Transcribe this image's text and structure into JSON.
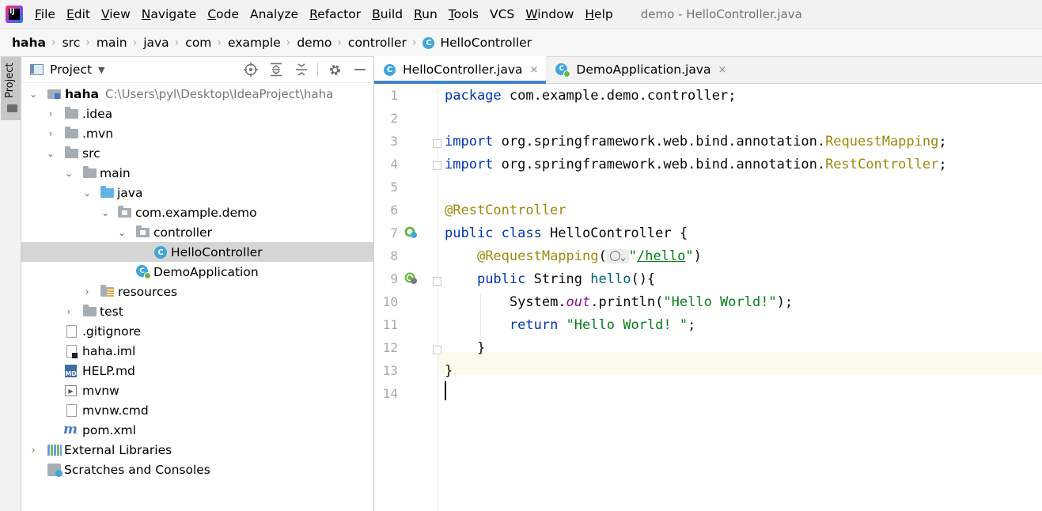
{
  "menu": {
    "items": [
      {
        "label": "File",
        "mnemonic": "F",
        "rest": "ile"
      },
      {
        "label": "Edit",
        "mnemonic": "E",
        "rest": "dit"
      },
      {
        "label": "View",
        "mnemonic": "V",
        "rest": "iew"
      },
      {
        "label": "Navigate",
        "mnemonic": "N",
        "rest": "avigate"
      },
      {
        "label": "Code",
        "mnemonic": "C",
        "rest": "ode"
      },
      {
        "label": "Analyze",
        "mnemonic": "",
        "rest": "Analyze"
      },
      {
        "label": "Refactor",
        "mnemonic": "R",
        "rest": "efactor"
      },
      {
        "label": "Build",
        "mnemonic": "B",
        "rest": "uild"
      },
      {
        "label": "Run",
        "mnemonic": "R",
        "rest": "un"
      },
      {
        "label": "Tools",
        "mnemonic": "T",
        "rest": "ools"
      },
      {
        "label": "VCS",
        "mnemonic": "",
        "rest": "VCS"
      },
      {
        "label": "Window",
        "mnemonic": "W",
        "rest": "indow"
      },
      {
        "label": "Help",
        "mnemonic": "H",
        "rest": "elp"
      }
    ],
    "window_title": "demo - HelloController.java",
    "logo_text": "IJ"
  },
  "breadcrumb": {
    "root": "haha",
    "items": [
      "src",
      "main",
      "java",
      "com",
      "example",
      "demo",
      "controller"
    ],
    "current": "HelloController"
  },
  "sidebar_stripe": {
    "label": "Project"
  },
  "project_panel": {
    "title": "Project",
    "tools": [
      "locate-icon",
      "expand-all-icon",
      "collapse-all-icon",
      "gear-icon",
      "minimize-icon"
    ],
    "tree": [
      {
        "label": "haha",
        "path": "C:\\Users\\pyl\\Desktop\\IdeaProject\\haha"
      },
      {
        "label": ".idea"
      },
      {
        "label": ".mvn"
      },
      {
        "label": "src"
      },
      {
        "label": "main"
      },
      {
        "label": "java"
      },
      {
        "label": "com.example.demo"
      },
      {
        "label": "controller"
      },
      {
        "label": "HelloController"
      },
      {
        "label": "DemoApplication"
      },
      {
        "label": "resources"
      },
      {
        "label": "test"
      },
      {
        "label": ".gitignore"
      },
      {
        "label": "haha.iml"
      },
      {
        "label": "HELP.md"
      },
      {
        "label": "mvnw"
      },
      {
        "label": "mvnw.cmd"
      },
      {
        "label": "pom.xml"
      },
      {
        "label": "External Libraries"
      },
      {
        "label": "Scratches and Consoles"
      }
    ],
    "md_badge": "MD",
    "pom_glyph": "m",
    "class_glyph": "C"
  },
  "editor": {
    "tabs": [
      {
        "label": "HelloController.java",
        "close": "×"
      },
      {
        "label": "DemoApplication.java",
        "close": "×"
      }
    ],
    "line_numbers": [
      "1",
      "2",
      "3",
      "4",
      "5",
      "6",
      "7",
      "8",
      "9",
      "10",
      "11",
      "12",
      "13",
      "14"
    ],
    "code": {
      "l1_kw": "package",
      "l1_rest": " com.example.demo.controller;",
      "l3_kw": "import",
      "l3_pkg": " org.springframework.web.bind.annotation.",
      "l3_cls": "RequestMapping",
      "l3_end": ";",
      "l4_kw": "import",
      "l4_pkg": " org.springframework.web.bind.annotation.",
      "l4_cls": "RestController",
      "l4_end": ";",
      "l6_ann": "@RestController",
      "l7_kw": "public class",
      "l7_rest": " HelloController {",
      "l8_indent": "    ",
      "l8_ann": "@RequestMapping",
      "l8_open": "(",
      "l8_q1": "\"",
      "l8_url": "/hello",
      "l8_q2": "\"",
      "l8_close": ")",
      "l9_indent": "    ",
      "l9_kw": "public",
      "l9_type": " String ",
      "l9_mth": "hello",
      "l9_rest": "(){",
      "l10_indent": "        ",
      "l10_a": "System.",
      "l10_fld": "out",
      "l10_b": ".println(",
      "l10_str": "\"Hello World!\"",
      "l10_c": ");",
      "l11_indent": "        ",
      "l11_kw": "return",
      "l11_sp": " ",
      "l11_str": "\"Hello World! \"",
      "l11_end": ";",
      "l12": "    }",
      "l13": "}"
    }
  }
}
